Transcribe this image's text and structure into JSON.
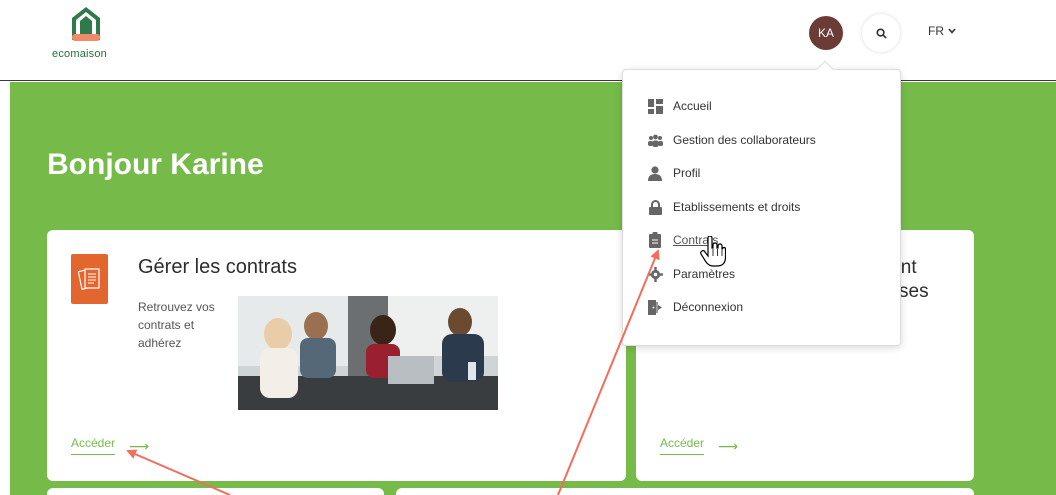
{
  "brand": {
    "name": "ecomaison"
  },
  "header": {
    "avatar_initials": "KA",
    "language": "FR"
  },
  "main": {
    "greeting": "Bonjour Karine",
    "cards": [
      {
        "title": "Gérer les contrats",
        "description": "Retrouvez vos contrats et adhérez",
        "access_label": "Accéder"
      },
      {
        "title_line1": "iant",
        "title_line2": "ses",
        "access_label": "Accéder"
      }
    ]
  },
  "menu": {
    "items": [
      {
        "label": "Accueil",
        "icon": "dashboard-icon"
      },
      {
        "label": "Gestion des collaborateurs",
        "icon": "users-icon"
      },
      {
        "label": "Profil",
        "icon": "user-icon"
      },
      {
        "label": "Etablissements et droits",
        "icon": "lock-icon"
      },
      {
        "label": "Contrats",
        "icon": "clipboard-icon"
      },
      {
        "label": "Paramètres",
        "icon": "gear-icon"
      },
      {
        "label": "Déconnexion",
        "icon": "logout-icon"
      }
    ]
  },
  "colors": {
    "green": "#76bb4a",
    "orange": "#e2662d",
    "avatar": "#6b3b35",
    "annotation_arrow": "#f26d5b"
  }
}
